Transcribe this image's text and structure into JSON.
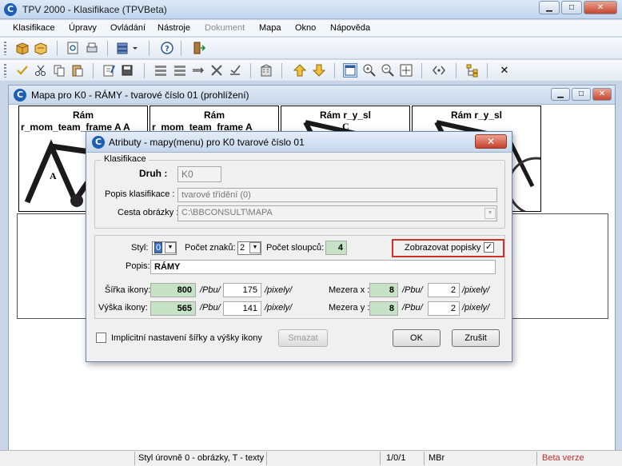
{
  "app": {
    "title": "TPV 2000 - Klasifikace (TPVBeta)",
    "icon_letter": "C",
    "min": "▁",
    "max": "□",
    "close": "✕"
  },
  "menu": [
    "Klasifikace",
    "Úpravy",
    "Ovládání",
    "Nástroje",
    "Dokument",
    "Mapa",
    "Okno",
    "Nápověda"
  ],
  "toolbar1": {
    "help": "?",
    "icons": [
      "box-icon",
      "box-open-icon",
      "preview-icon",
      "print-icon",
      "layers-icon",
      "help-icon",
      "exit-door-icon"
    ]
  },
  "toolbar2": {
    "up": "⇧",
    "down": "⇩",
    "close": "✕",
    "icons": [
      "check-icon",
      "cut-icon",
      "copy-icon",
      "paste-icon",
      "edit-icon",
      "save-icon",
      "tree-a-icon",
      "tree-b-icon",
      "tree-c-icon",
      "cross-icon",
      "check-line-icon",
      "building-icon",
      "arrow-up-icon",
      "arrow-down-icon",
      "window-icon",
      "zoom-in-icon",
      "zoom-out-icon",
      "zoom-fit-icon",
      "brackets-icon",
      "hierarchy-icon",
      "close-icon"
    ]
  },
  "mapwin": {
    "title": "Mapa pro K0 - RÁMY - tvarové číslo 01 (prohlížení)",
    "thumbs": [
      {
        "label": "Rám",
        "sub": "r_mom_team_frame A A"
      },
      {
        "label": "Rám",
        "sub": "r_mom_team_frame A"
      },
      {
        "label": "Rám r_y_sl",
        "sub": ""
      },
      {
        "label": "Rám r_y_sl",
        "sub": ""
      }
    ],
    "thumb_letters": [
      "A",
      "C"
    ]
  },
  "dialog": {
    "title": "Atributy - mapy(menu) pro K0 tvarové číslo 01",
    "close": "✕",
    "group_label": "Klasifikace",
    "druh_label": "Druh :",
    "druh_value": "K0",
    "popis_klas_label": "Popis klasifikace :",
    "popis_klas_value": "tvarové třídění (0)",
    "cesta_label": "Cesta obrázky :",
    "cesta_value": "C:\\BBCONSULT\\MAPA",
    "styl_label": "Styl:",
    "styl_value": "0",
    "pocet_znaku_label": "Počet znaků:",
    "pocet_znaku_value": "2",
    "pocet_sloupcu_label": "Počet sloupců:",
    "pocet_sloupcu_value": "4",
    "zobrazovat_label": "Zobrazovat popisky",
    "zobrazovat_checked": "✓",
    "popis_label": "Popis:",
    "popis_value": "RÁMY",
    "sirka_label": "Šířka ikony:",
    "sirka_pbu": "800",
    "sirka_px": "175",
    "vyska_label": "Výška ikony:",
    "vyska_pbu": "565",
    "vyska_px": "141",
    "mezera_x_label": "Mezera x :",
    "mezera_x_pbu": "8",
    "mezera_x_px": "2",
    "mezera_y_label": "Mezera y :",
    "mezera_y_pbu": "8",
    "mezera_y_px": "2",
    "unit_pbu": "/Pbu/",
    "unit_px": "/pixely/",
    "implicitni_label": "Implicitní nastavení šířky a výšky ikony",
    "smazat": "Smazat",
    "ok": "OK",
    "zrusit": "Zrušit"
  },
  "status": {
    "text": "Styl úrovně 0 - obrázky, T - texty",
    "counter": "1/0/1",
    "unit": "MBr",
    "version": "Beta verze"
  },
  "colors": {
    "accent_green": "#c6e3c6",
    "highlight_red": "#d0302a",
    "version_red": "#c0302a"
  }
}
